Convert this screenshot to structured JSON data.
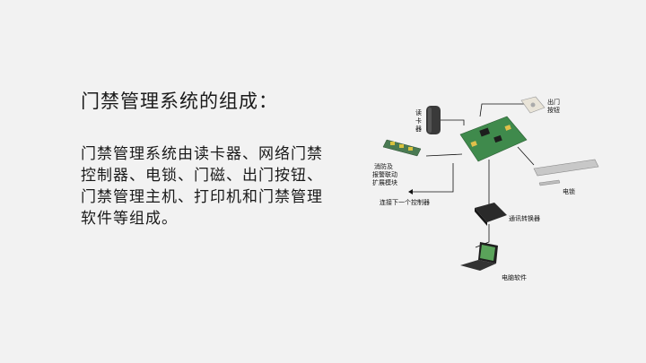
{
  "slide": {
    "title": "门禁管理系统的组成：",
    "body": "门禁管理系统由读卡器、网络门禁控制器、电锁、门磁、出门按钮、门禁管理主机、打印机和门禁管理软件等组成。"
  },
  "diagram": {
    "labels": {
      "reader": "读卡器",
      "exit_button": [
        "出门",
        "按钮"
      ],
      "fire_module": [
        "消防及",
        "报警联动",
        "扩展模块"
      ],
      "lock": "电锁",
      "next_controller": "连接下一个控制器",
      "converter": "通讯转换器",
      "software": "电脑软件"
    },
    "colors": {
      "board_green": "#3f8a4c",
      "card_reader": "#3a3a3a",
      "wire": "#111111",
      "lock_silver": "#c8c8c8",
      "exit_button": "#e9e4d8"
    }
  }
}
